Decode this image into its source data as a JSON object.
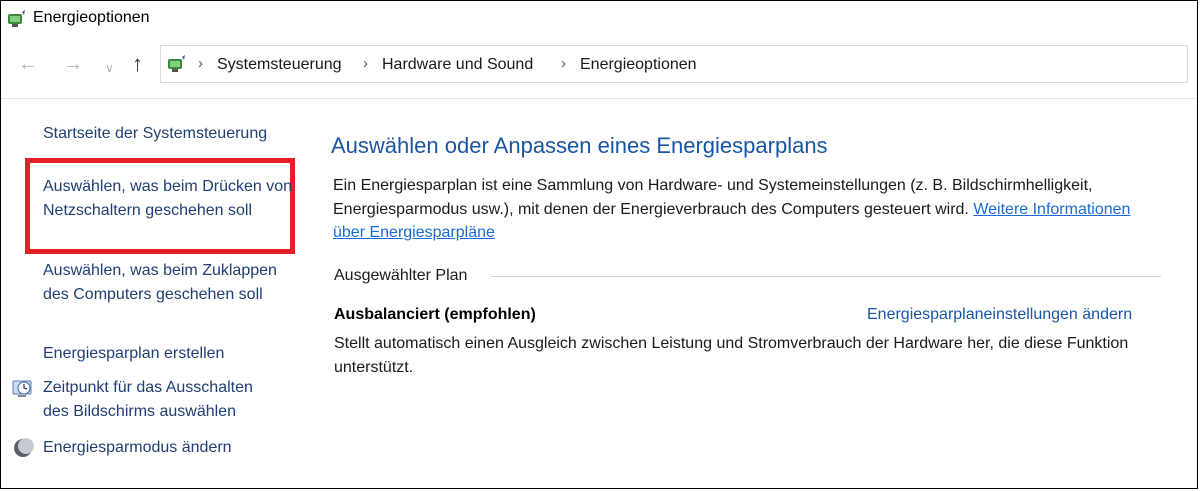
{
  "window": {
    "title": "Energieoptionen",
    "icon": "power-options-icon"
  },
  "nav": {
    "back_icon": "←",
    "forward_icon": "→",
    "recent_icon": "∨",
    "up_icon": "↑"
  },
  "breadcrumb": {
    "items": [
      "Systemsteuerung",
      "Hardware und Sound",
      "Energieoptionen"
    ],
    "separator": "›"
  },
  "sidebar": {
    "home": "Startseite der Systemsteuerung",
    "power_buttons": "Auswählen, was beim Drücken von Netzschaltern geschehen soll",
    "lid": "Auswählen, was beim Zuklappen des Computers geschehen soll",
    "create_plan": "Energiesparplan erstellen",
    "display_off": "Zeitpunkt für das Ausschalten des Bildschirms auswählen",
    "sleep": "Energiesparmodus ändern"
  },
  "main": {
    "title": "Auswählen oder Anpassen eines Energiesparplans",
    "description": "Ein Energiesparplan ist eine Sammlung von Hardware- und Systemeinstellungen (z. B. Bildschirmhelligkeit, Energiesparmodus usw.), mit denen der Energieverbrauch des Computers gesteuert wird.",
    "more_info_link": "Weitere Informationen über Energiesparpläne",
    "selected_plan_label": "Ausgewählter Plan",
    "plan": {
      "name": "Ausbalanciert (empfohlen)",
      "change_link": "Energiesparplaneinstellungen ändern",
      "description": "Stellt automatisch einen Ausgleich zwischen Leistung und Stromverbrauch der Hardware her, die diese Funktion unterstützt."
    }
  },
  "colors": {
    "link": "#1f3e73",
    "heading": "#1a55a4",
    "hyperlink": "#1a6bd6",
    "highlight": "#e31e26"
  }
}
